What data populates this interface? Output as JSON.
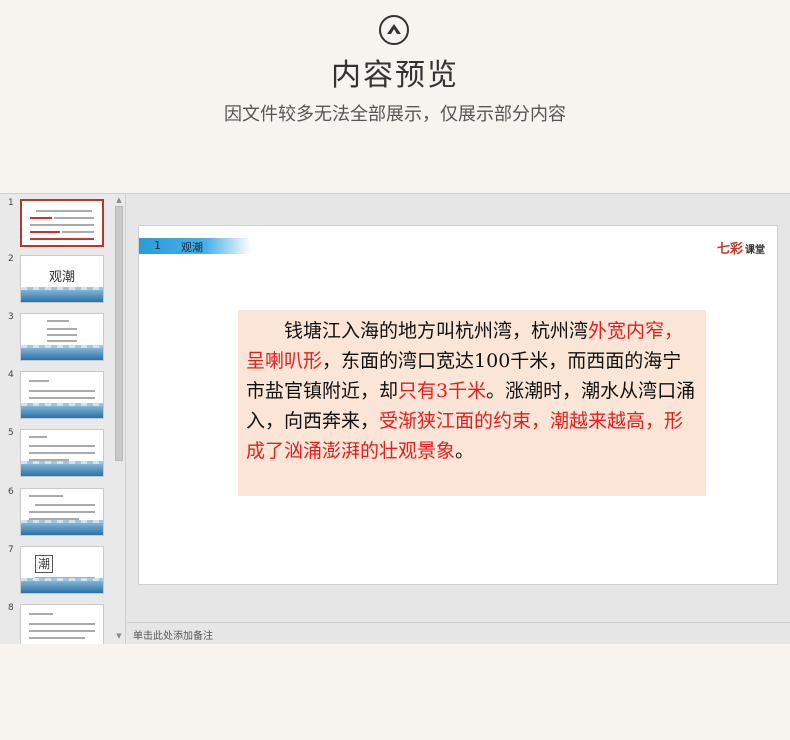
{
  "header": {
    "icon": "up-chevron-circle-icon",
    "title": "内容预览",
    "subtitle": "因文件较多无法全部展示，仅展示部分内容"
  },
  "thumbnails": [
    {
      "num": "1",
      "active": true
    },
    {
      "num": "2",
      "title": "观潮"
    },
    {
      "num": "3"
    },
    {
      "num": "4"
    },
    {
      "num": "5"
    },
    {
      "num": "6"
    },
    {
      "num": "7",
      "char": "潮"
    },
    {
      "num": "8"
    }
  ],
  "slide": {
    "tab_num": "1",
    "tab_label": "观潮",
    "brand_main": "七彩",
    "brand_sub": "课堂",
    "paragraph": [
      {
        "text": "　　钱塘江入海的地方叫杭州湾，杭州湾",
        "red": false
      },
      {
        "text": "外宽内窄，呈喇叭形",
        "red": true
      },
      {
        "text": "，东面的湾口宽达100千米，而西面的海宁市盐官镇附近，却",
        "red": false
      },
      {
        "text": "只有3千米",
        "red": true
      },
      {
        "text": "。涨潮时，潮水从湾口涌入，向西奔来，",
        "red": false
      },
      {
        "text": "受渐狭江面的约束，潮越来越高，形成了汹涌澎湃的壮观景象",
        "red": true
      },
      {
        "text": "。",
        "red": false
      }
    ]
  },
  "notes": {
    "placeholder": "单击此处添加备注"
  },
  "colors": {
    "accent_red": "#e02020",
    "tab_blue": "#2c9bd6",
    "textbox_bg": "#fbe5d6"
  }
}
